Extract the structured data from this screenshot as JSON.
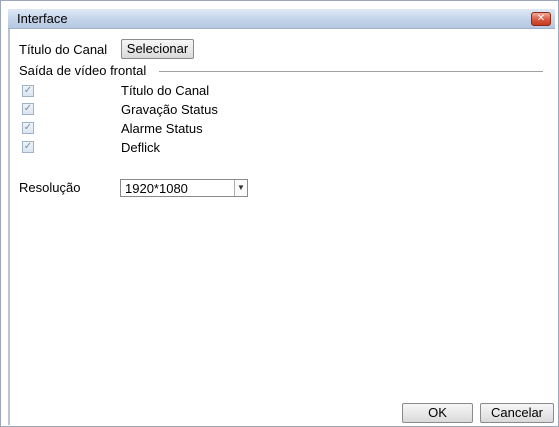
{
  "window": {
    "title": "Interface",
    "close_glyph": "✕"
  },
  "channel_title": {
    "label": "Título do Canal",
    "button": "Selecionar"
  },
  "front_output": {
    "group_label": "Saída de vídeo frontal",
    "options": [
      {
        "label": "Título do Canal",
        "checked": true
      },
      {
        "label": "Gravação Status",
        "checked": true
      },
      {
        "label": "Alarme Status",
        "checked": true
      },
      {
        "label": "Deflick",
        "checked": true
      }
    ],
    "check_glyph": "✓"
  },
  "resolution": {
    "label": "Resolução",
    "value": "1920*1080",
    "arrow_glyph": "▼"
  },
  "footer": {
    "ok": "OK",
    "cancel": "Cancelar"
  }
}
